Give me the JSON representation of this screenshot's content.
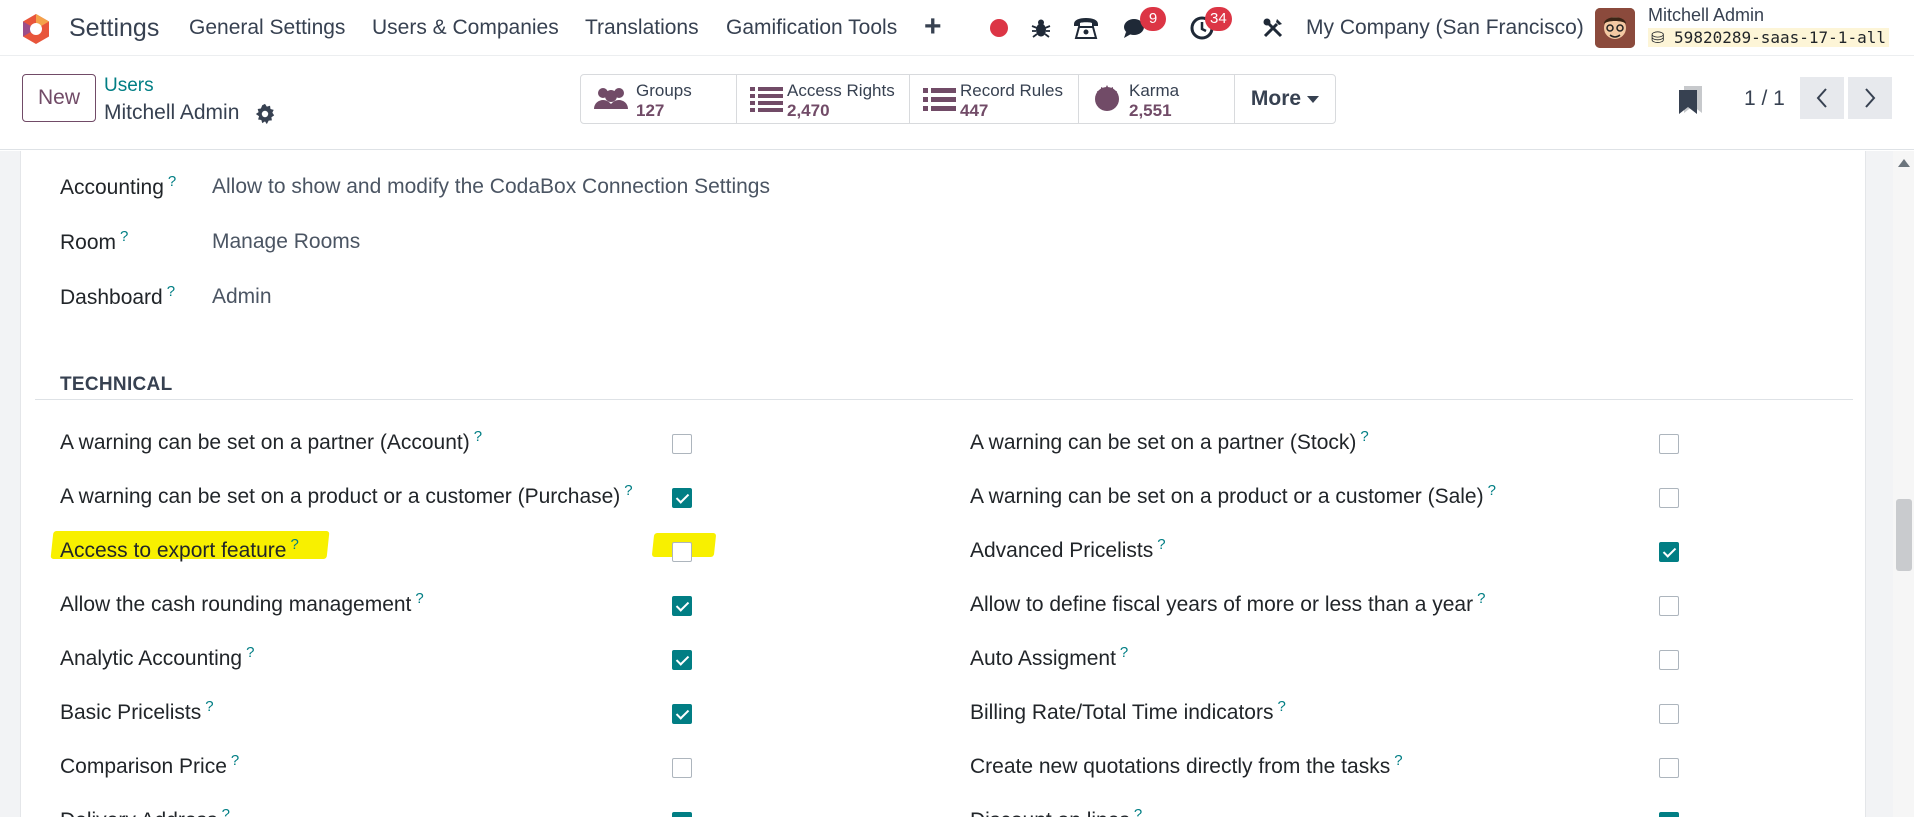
{
  "topnav": {
    "app_name": "Settings",
    "menus": [
      "General Settings",
      "Users & Companies",
      "Translations",
      "Gamification Tools"
    ],
    "messages_badge": "9",
    "activities_badge": "34",
    "company": "My Company (San Francisco)",
    "user_name": "Mitchell Admin",
    "database": "59820289-saas-17-1-all",
    "brand_color": "#714b67",
    "accent_color": "#017e84"
  },
  "control_panel": {
    "new_label": "New",
    "breadcrumb_parent": "Users",
    "breadcrumb_current": "Mitchell Admin",
    "smart_buttons": [
      {
        "label": "Groups",
        "value": "127",
        "icon": "users-icon"
      },
      {
        "label": "Access Rights",
        "value": "2,470",
        "icon": "list-icon"
      },
      {
        "label": "Record Rules",
        "value": "447",
        "icon": "list-icon"
      },
      {
        "label": "Karma",
        "value": "2,551",
        "icon": "karma-badge-icon"
      }
    ],
    "more_label": "More",
    "pager": "1 / 1"
  },
  "form": {
    "top_fields": [
      {
        "label": "Accounting",
        "value": "Allow to show and modify the CodaBox Connection Settings"
      },
      {
        "label": "Room",
        "value": "Manage Rooms"
      },
      {
        "label": "Dashboard",
        "value": "Admin"
      }
    ],
    "technical_title": "TECHNICAL",
    "technical_left": [
      {
        "label": "A warning can be set on a partner (Account)",
        "checked": false
      },
      {
        "label": "A warning can be set on a product or a customer (Purchase)",
        "checked": true
      },
      {
        "label": "Access to export feature",
        "checked": false,
        "highlighted": true
      },
      {
        "label": "Allow the cash rounding management",
        "checked": true
      },
      {
        "label": "Analytic Accounting",
        "checked": true
      },
      {
        "label": "Basic Pricelists",
        "checked": true
      },
      {
        "label": "Comparison Price",
        "checked": false
      },
      {
        "label": "Delivery Address",
        "checked": true
      }
    ],
    "technical_right": [
      {
        "label": "A warning can be set on a partner (Stock)",
        "checked": false
      },
      {
        "label": "A warning can be set on a product or a customer (Sale)",
        "checked": false
      },
      {
        "label": "Advanced Pricelists",
        "checked": true
      },
      {
        "label": "Allow to define fiscal years of more or less than a year",
        "checked": false
      },
      {
        "label": "Auto Assigment",
        "checked": false
      },
      {
        "label": "Billing Rate/Total Time indicators",
        "checked": false
      },
      {
        "label": "Create new quotations directly from the tasks",
        "checked": false
      },
      {
        "label": "Discount on lines",
        "checked": true
      }
    ],
    "help_mark": "?"
  }
}
